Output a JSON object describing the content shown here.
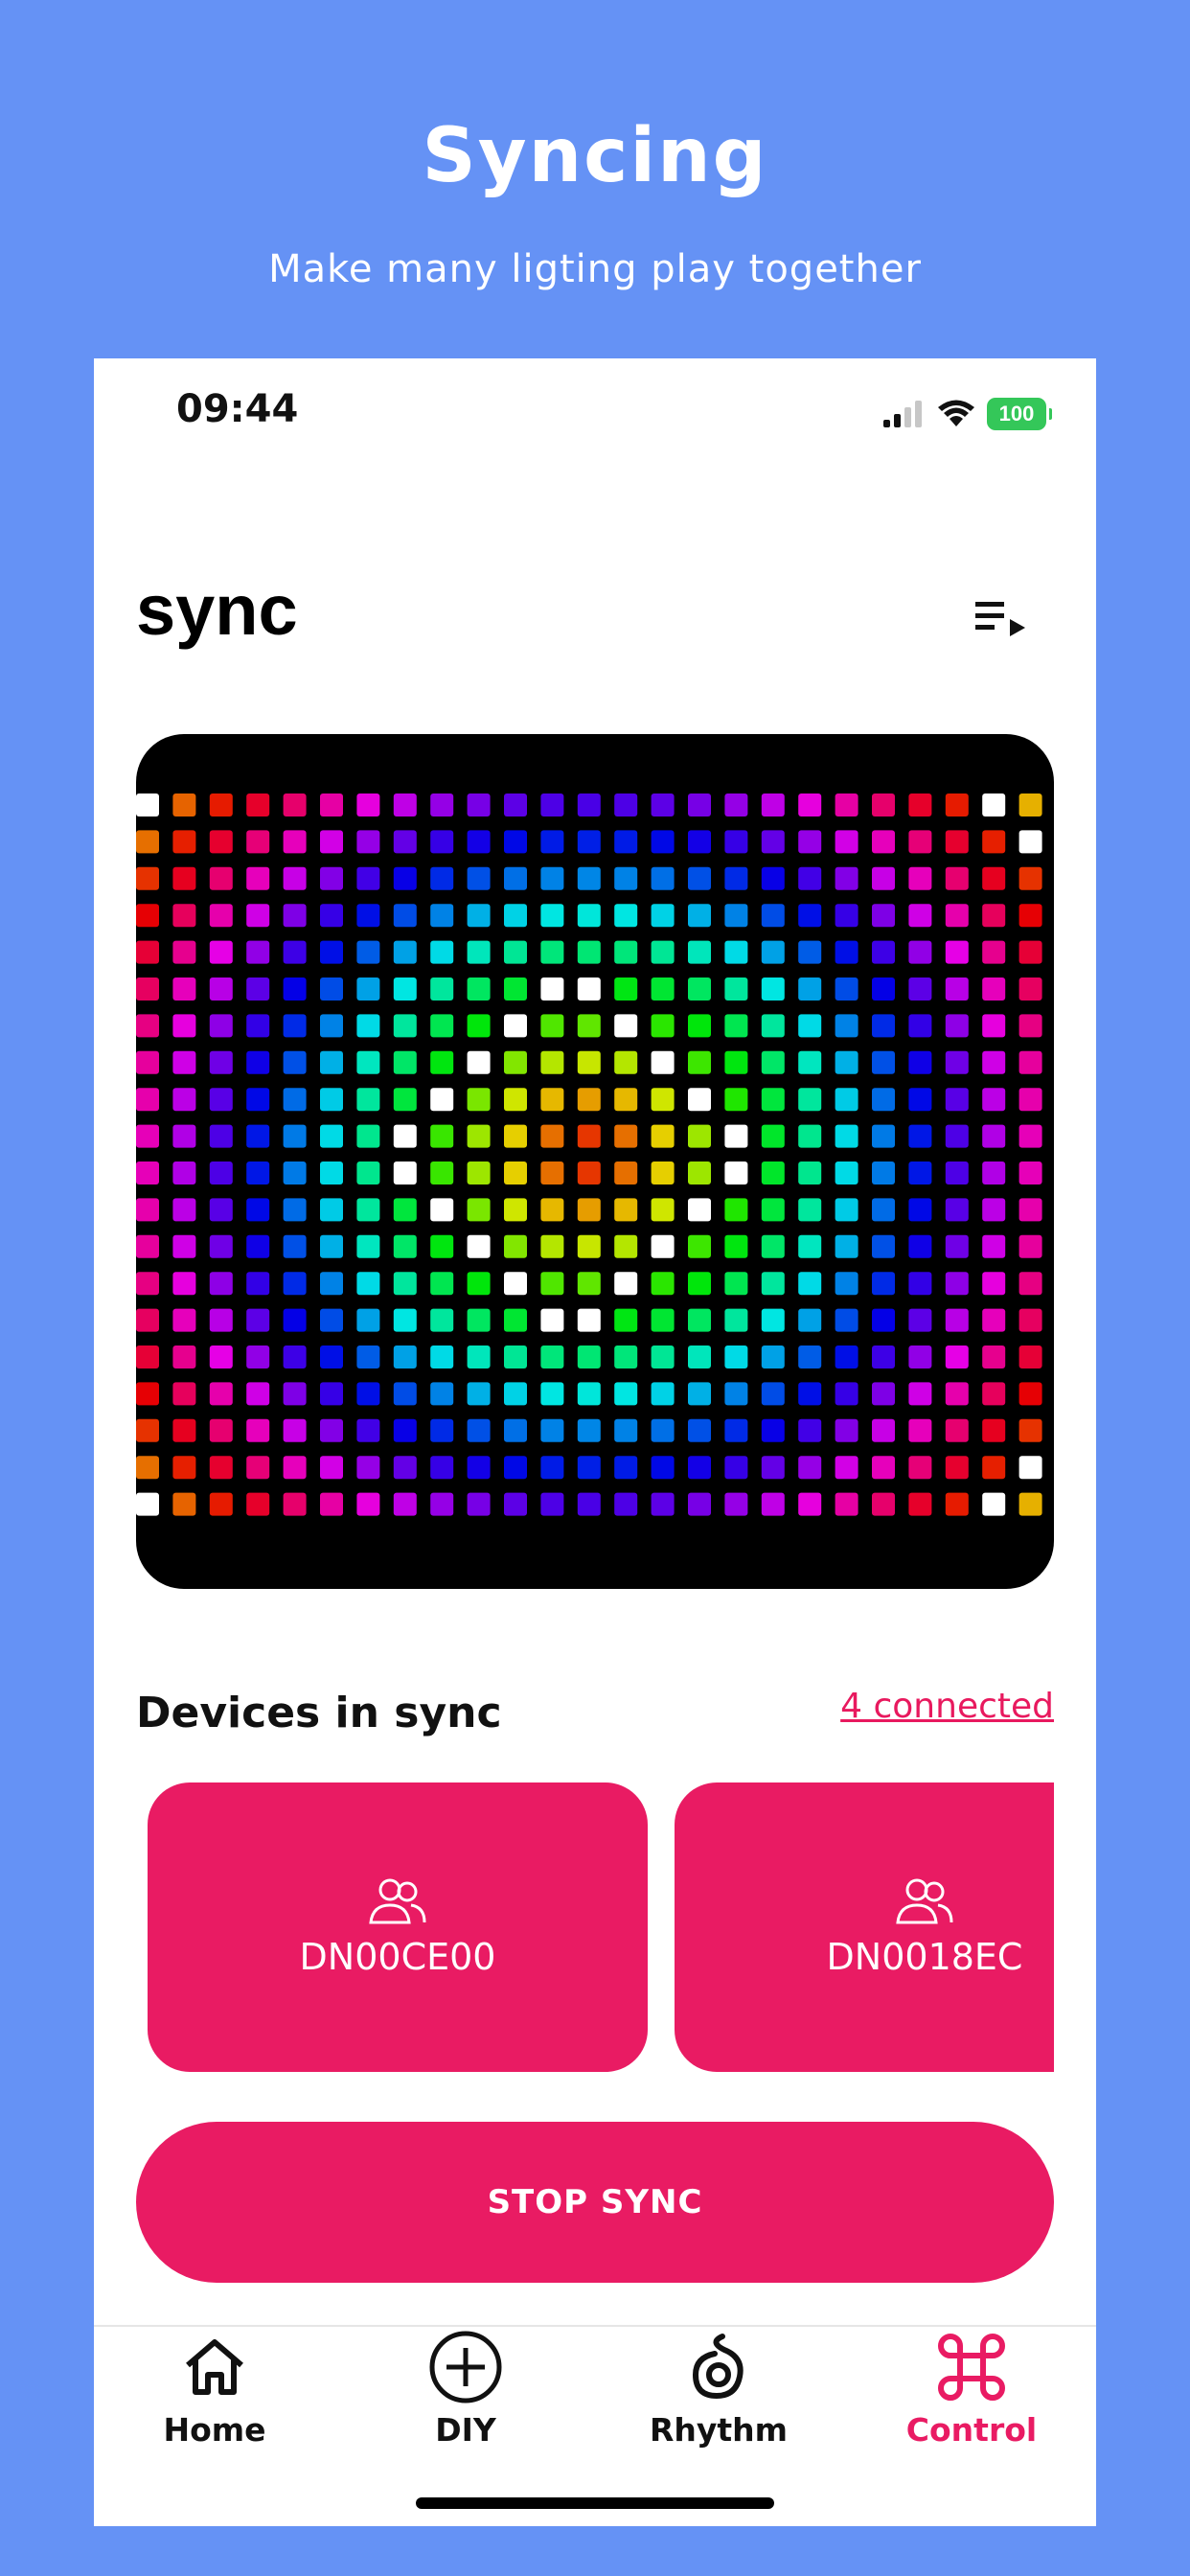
{
  "promo": {
    "title": "Syncing",
    "subtitle": "Make many ligting play together"
  },
  "status_bar": {
    "time": "09:44",
    "battery": "100",
    "icons": [
      "cellular-signal-icon",
      "wifi-icon",
      "battery-icon"
    ]
  },
  "page": {
    "title": "sync",
    "playlist_icon": "playlist-play-icon"
  },
  "led_matrix": {
    "description_colors": {
      "white": "#ffffff"
    }
  },
  "devices": {
    "section_label": "Devices in sync",
    "connected_link": "4 connected",
    "items": [
      {
        "name": "DN00CE00",
        "icon": "users-icon"
      },
      {
        "name": "DN0018EC",
        "icon": "users-icon"
      }
    ]
  },
  "actions": {
    "stop_sync": "STOP SYNC"
  },
  "tabbar": {
    "items": [
      {
        "label": "Home",
        "icon": "home-icon",
        "active": false
      },
      {
        "label": "DIY",
        "icon": "plus-circle-icon",
        "active": false
      },
      {
        "label": "Rhythm",
        "icon": "rhythm-icon",
        "active": false
      },
      {
        "label": "Control",
        "icon": "command-icon",
        "active": true
      }
    ]
  },
  "colors": {
    "background": "#6592F5",
    "accent": "#E91B63",
    "battery_green": "#34C759"
  }
}
